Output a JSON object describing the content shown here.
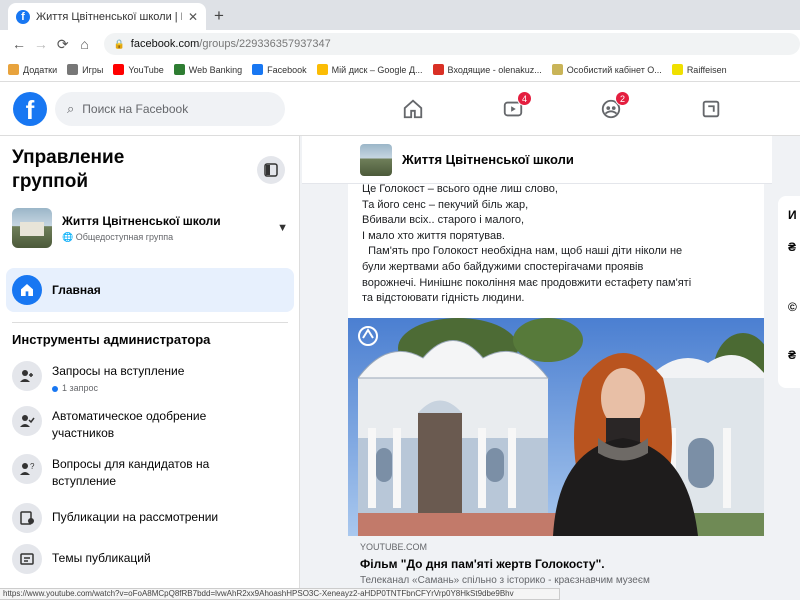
{
  "browser": {
    "tab_title": "Життя Цвітненської школи | Facebook",
    "url_host": "facebook.com",
    "url_path": "/groups/229336357937347",
    "bookmarks": [
      {
        "label": "Додатки",
        "color": "#e8a33d"
      },
      {
        "label": "Игры",
        "color": "#777777"
      },
      {
        "label": "YouTube",
        "color": "#ff0000"
      },
      {
        "label": "Web Banking",
        "color": "#2e7d32"
      },
      {
        "label": "Facebook",
        "color": "#1877f2"
      },
      {
        "label": "Мій диск – Google Д...",
        "color": "#fbbc04"
      },
      {
        "label": "Входящие - olenakuz...",
        "color": "#d93025"
      },
      {
        "label": "Особистий кабінет О...",
        "color": "#c9b458"
      },
      {
        "label": "Raiffeisen",
        "color": "#f0e000"
      }
    ],
    "status_url": "https://www.youtube.com/watch?v=oFoA8MCpQ8fRB7bdd=lvwAhR2xx9AhoashHPSO3C-Xeneayz2-aHDP0TNTFbnCFYrVrp0Y8HkSt9dbe9Bhv"
  },
  "facebook": {
    "search_placeholder": "Поиск на Facebook",
    "video_badge": "4",
    "groups_badge": "2"
  },
  "sidebar": {
    "title": "Управление группой",
    "group_name": "Життя Цвітненської школи",
    "group_privacy": "Общедоступная группа",
    "home_label": "Главная",
    "section_title": "Инструменты администратора",
    "items": [
      {
        "label": "Запросы на вступление",
        "sub": "1 запрос"
      },
      {
        "label": "Автоматическое одобрение участников",
        "sub": ""
      },
      {
        "label": "Вопросы для кандидатов на вступление",
        "sub": ""
      },
      {
        "label": "Публикации на рассмотрении",
        "sub": ""
      },
      {
        "label": "Темы публикаций",
        "sub": ""
      }
    ]
  },
  "post": {
    "group_name": "Життя Цвітненської школи",
    "text_lines": [
      "Це Голокост – всього одне лиш слово,",
      "Та його сенс – пекучий біль жар,",
      "Вбивали всіх.. старого і малого,",
      "І мало хто життя порятував.",
      "  Пам'ять про Голокост необхідна нам, щоб наші діти ніколи не",
      "були жертвами або байдужими спостерігачами проявів",
      "ворожнечі. Нинішнє покоління має продовжити естафету пам'яті",
      "та відстоювати гідність людини."
    ],
    "link_domain": "YOUTUBE.COM",
    "link_title": "Фільм \"До дня пам'яті жертв Голокосту\".",
    "link_desc": "Телеканал «Самань» спільно з історико - краєзнавчим музеєм"
  },
  "right_column": {
    "letters": [
      "И",
      "₴",
      "©",
      "₴"
    ]
  }
}
